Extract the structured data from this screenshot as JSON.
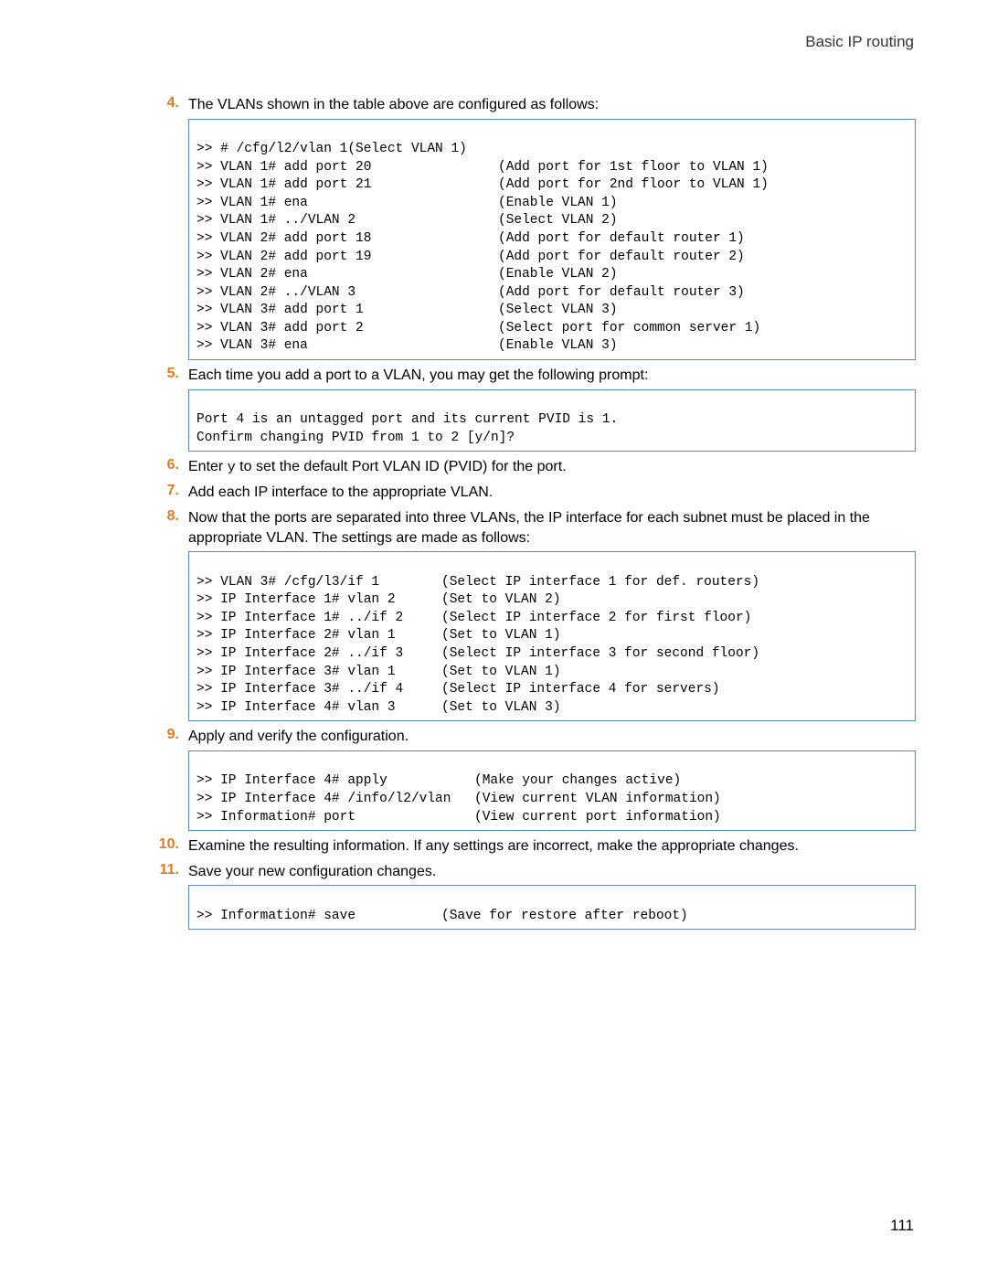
{
  "header": {
    "title": "Basic IP routing"
  },
  "page_number": "111",
  "steps": {
    "s4": {
      "num": "4.",
      "text": "The VLANs shown in the table above are configured as follows:",
      "code": [
        {
          "cmd": ">> # /cfg/l2/vlan 1(Select VLAN 1)",
          "comment": ""
        },
        {
          "cmd": ">> VLAN 1# add port 20",
          "comment": "(Add port for 1st floor to VLAN 1)"
        },
        {
          "cmd": ">> VLAN 1# add port 21",
          "comment": "(Add port for 2nd floor to VLAN 1)"
        },
        {
          "cmd": ">> VLAN 1# ena",
          "comment": "(Enable VLAN 1)"
        },
        {
          "cmd": ">> VLAN 1# ../VLAN 2",
          "comment": "(Select VLAN 2)"
        },
        {
          "cmd": ">> VLAN 2# add port 18",
          "comment": "(Add port for default router 1)"
        },
        {
          "cmd": ">> VLAN 2# add port 19",
          "comment": "(Add port for default router 2)"
        },
        {
          "cmd": ">> VLAN 2# ena",
          "comment": "(Enable VLAN 2)"
        },
        {
          "cmd": ">> VLAN 2# ../VLAN 3",
          "comment": "(Add port for default router 3)"
        },
        {
          "cmd": ">> VLAN 3# add port 1",
          "comment": "(Select VLAN 3)"
        },
        {
          "cmd": ">> VLAN 3# add port 2",
          "comment": "(Select port for common server 1)"
        },
        {
          "cmd": ">> VLAN 3# ena",
          "comment": "(Enable VLAN 3)"
        }
      ]
    },
    "s5": {
      "num": "5.",
      "text": "Each time you add a port to a VLAN, you may get the following prompt:",
      "code": [
        {
          "cmd": "Port 4 is an untagged port and its current PVID is 1.",
          "comment": ""
        },
        {
          "cmd": "Confirm changing PVID from 1 to 2 [y/n]?",
          "comment": ""
        }
      ]
    },
    "s6": {
      "num": "6.",
      "text_pre": "Enter ",
      "code_inline": "y",
      "text_post": " to set the default Port VLAN ID (PVID) for the port."
    },
    "s7": {
      "num": "7.",
      "text": "Add each IP interface to the appropriate VLAN."
    },
    "s8": {
      "num": "8.",
      "text": "Now that the ports are separated into three VLANs, the IP interface for each subnet must be placed in the appropriate VLAN. The settings are made as follows:",
      "code": [
        {
          "cmd": ">> VLAN 3# /cfg/l3/if 1",
          "comment": "(Select IP interface 1 for def. routers)"
        },
        {
          "cmd": ">> IP Interface 1# vlan 2",
          "comment": "(Set to VLAN 2)"
        },
        {
          "cmd": ">> IP Interface 1# ../if 2",
          "comment": "(Select IP interface 2 for first floor)"
        },
        {
          "cmd": ">> IP Interface 2# vlan 1",
          "comment": "(Set to VLAN 1)"
        },
        {
          "cmd": ">> IP Interface 2# ../if 3",
          "comment": "(Select IP interface 3 for second floor)"
        },
        {
          "cmd": ">> IP Interface 3# vlan 1",
          "comment": "(Set to VLAN 1)"
        },
        {
          "cmd": ">> IP Interface 3# ../if 4",
          "comment": "(Select IP interface 4 for servers)"
        },
        {
          "cmd": ">> IP Interface 4# vlan 3",
          "comment": "(Set to VLAN 3)"
        }
      ]
    },
    "s9": {
      "num": "9.",
      "text": "Apply and verify the configuration.",
      "code": [
        {
          "cmd": ">> IP Interface 4# apply",
          "comment": "(Make your changes active)"
        },
        {
          "cmd": ">> IP Interface 4# /info/l2/vlan",
          "comment": "(View current VLAN information)"
        },
        {
          "cmd": ">> Information# port",
          "comment": "(View current port information)"
        }
      ]
    },
    "s10": {
      "num": "10.",
      "text": "Examine the resulting information. If any settings are incorrect, make the appropriate changes."
    },
    "s11": {
      "num": "11.",
      "text": "Save your new configuration changes.",
      "code": [
        {
          "cmd": ">> Information# save",
          "comment": "(Save for restore after reboot)"
        }
      ]
    }
  }
}
